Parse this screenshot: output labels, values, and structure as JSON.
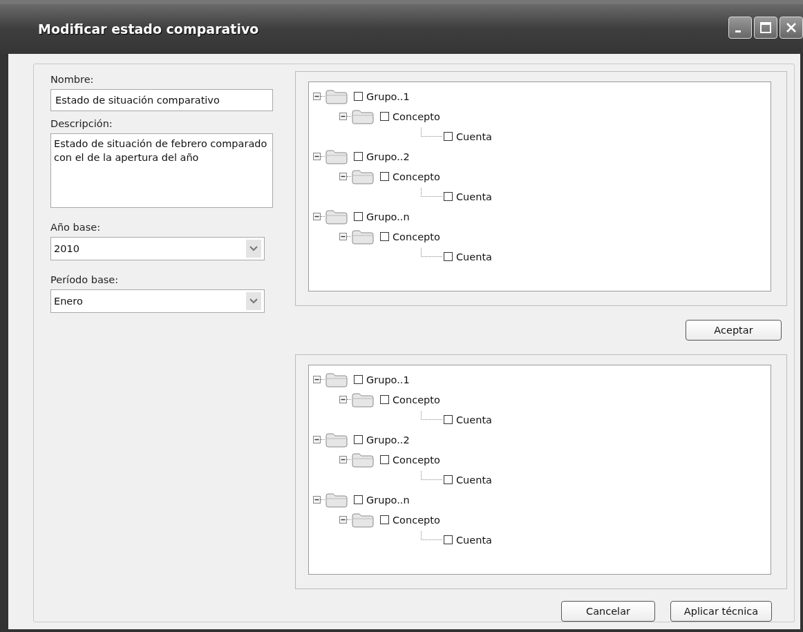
{
  "window": {
    "title": "Modificar estado comparativo"
  },
  "form": {
    "name_label": "Nombre:",
    "name_value": "Estado de situación comparativo",
    "description_label": "Descripción:",
    "description_value": "Estado de situación de febrero comparado con el de la apertura del año",
    "year_label": "Año base:",
    "year_value": "2010",
    "period_label": "Período base:",
    "period_value": "Enero"
  },
  "trees": [
    {
      "items": [
        {
          "label": "Grupo..1",
          "expanded": true,
          "checked": false,
          "children": [
            {
              "label": "Concepto",
              "expanded": true,
              "checked": false,
              "children": [
                {
                  "label": "Cuenta",
                  "checked": false
                }
              ]
            }
          ]
        },
        {
          "label": "Grupo..2",
          "expanded": true,
          "checked": false,
          "children": [
            {
              "label": "Concepto",
              "expanded": true,
              "checked": false,
              "children": [
                {
                  "label": "Cuenta",
                  "checked": false
                }
              ]
            }
          ]
        },
        {
          "label": "Grupo..n",
          "expanded": true,
          "checked": false,
          "children": [
            {
              "label": "Concepto",
              "expanded": true,
              "checked": false,
              "children": [
                {
                  "label": "Cuenta",
                  "checked": false
                }
              ]
            }
          ]
        }
      ]
    },
    {
      "items": [
        {
          "label": "Grupo..1",
          "expanded": true,
          "checked": false,
          "children": [
            {
              "label": "Concepto",
              "expanded": true,
              "checked": false,
              "children": [
                {
                  "label": "Cuenta",
                  "checked": false
                }
              ]
            }
          ]
        },
        {
          "label": "Grupo..2",
          "expanded": true,
          "checked": false,
          "children": [
            {
              "label": "Concepto",
              "expanded": true,
              "checked": false,
              "children": [
                {
                  "label": "Cuenta",
                  "checked": false
                }
              ]
            }
          ]
        },
        {
          "label": "Grupo..n",
          "expanded": true,
          "checked": false,
          "children": [
            {
              "label": "Concepto",
              "expanded": true,
              "checked": false,
              "children": [
                {
                  "label": "Cuenta",
                  "checked": false
                }
              ]
            }
          ]
        }
      ]
    }
  ],
  "accept_button": "Aceptar",
  "buttons": [
    "Cancelar",
    "Aplicar técnica"
  ]
}
